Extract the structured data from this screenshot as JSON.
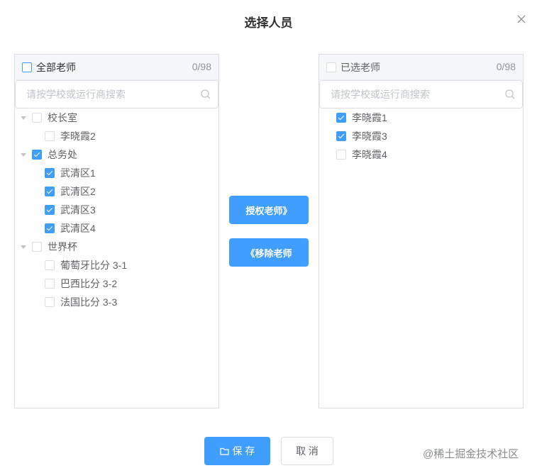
{
  "dialog": {
    "title": "选择人员"
  },
  "left_panel": {
    "header_label": "全部老师",
    "count": "0/98",
    "search_placeholder": "请按学校或运行商搜索",
    "tree": [
      {
        "label": "校长室",
        "checked": false,
        "children": [
          {
            "label": "李晓霞2",
            "checked": false
          }
        ]
      },
      {
        "label": "总务处",
        "checked": true,
        "children": [
          {
            "label": "武清区1",
            "checked": true
          },
          {
            "label": "武清区2",
            "checked": true
          },
          {
            "label": "武清区3",
            "checked": true
          },
          {
            "label": "武清区4",
            "checked": true
          }
        ]
      },
      {
        "label": "世界杯",
        "checked": false,
        "children": [
          {
            "label": "葡萄牙比分 3-1",
            "checked": false
          },
          {
            "label": "巴西比分 3-2",
            "checked": false
          },
          {
            "label": "法国比分 3-3",
            "checked": false
          }
        ]
      }
    ]
  },
  "right_panel": {
    "header_label": "已选老师",
    "count": "0/98",
    "search_placeholder": "请按学校或运行商搜索",
    "items": [
      {
        "label": "李晓霞1",
        "checked": true
      },
      {
        "label": "李晓霞3",
        "checked": true
      },
      {
        "label": "李晓霞4",
        "checked": false
      }
    ]
  },
  "actions": {
    "grant_label": "授权老师》",
    "remove_label": "《移除老师"
  },
  "footer": {
    "save_label": "保 存",
    "cancel_label": "取 消"
  },
  "watermark": "@稀土掘金技术社区",
  "colors": {
    "primary": "#409eff",
    "border": "#dcdfe6",
    "header_bg": "#f5f7fa"
  }
}
